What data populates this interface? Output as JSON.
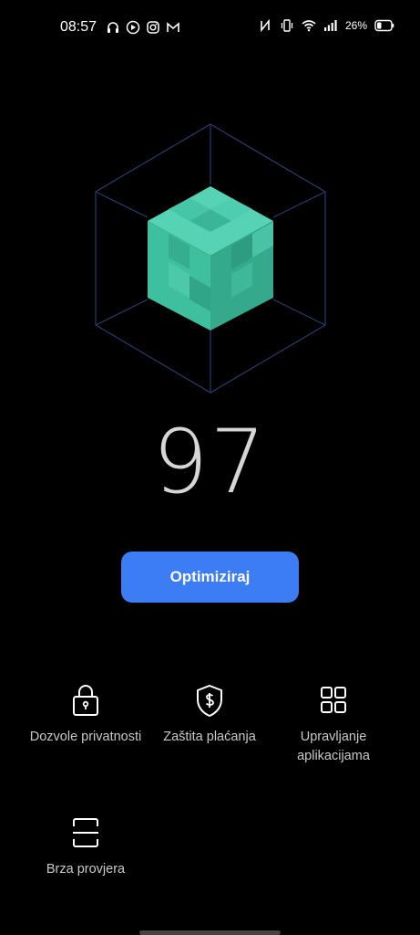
{
  "status_bar": {
    "time": "08:57",
    "battery_percent": "26%",
    "icons": [
      "headphones-icon",
      "play-icon",
      "instagram-icon",
      "gmail-icon",
      "nfc-icon",
      "vibrate-icon",
      "wifi-icon",
      "signal-icon",
      "battery-icon"
    ]
  },
  "score": {
    "value": "97"
  },
  "actions": {
    "optimize_label": "Optimiziraj"
  },
  "features": [
    {
      "label": "Dozvole privatnosti",
      "icon": "lock-icon"
    },
    {
      "label": "Zaštita plaćanja",
      "icon": "shield-dollar-icon"
    },
    {
      "label": "Upravljanje aplikacijama",
      "icon": "app-grid-icon"
    },
    {
      "label": "Brza provjera",
      "icon": "scan-icon"
    }
  ],
  "colors": {
    "accent": "#3c7cf5",
    "cube": "#3fbf9f",
    "background": "#000000"
  }
}
